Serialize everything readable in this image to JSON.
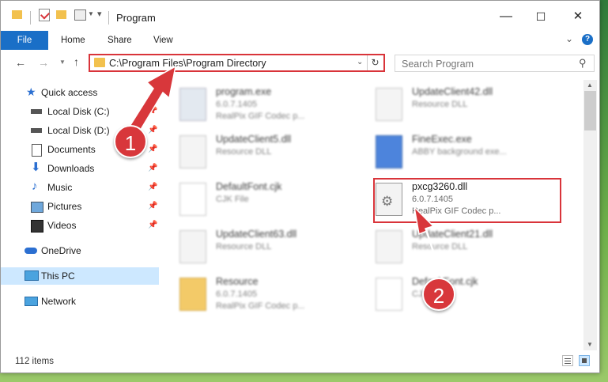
{
  "window": {
    "title": "Program"
  },
  "ribbon": {
    "tabs": [
      "File",
      "Home",
      "Share",
      "View"
    ],
    "help": "?"
  },
  "controls": {
    "minimize": "—",
    "maximize": "☐",
    "close": "✕"
  },
  "address": {
    "path": "C:\\Program Files\\Program Directory",
    "search_placeholder": "Search Program"
  },
  "sidebar": {
    "items": [
      {
        "label": "Quick access",
        "icon": "star-icon"
      },
      {
        "label": "Local Disk (C:)",
        "icon": "drive-icon",
        "pinned": true
      },
      {
        "label": "Local Disk (D:)",
        "icon": "drive-icon",
        "pinned": true
      },
      {
        "label": "Documents",
        "icon": "document-icon",
        "pinned": true
      },
      {
        "label": "Downloads",
        "icon": "download-icon",
        "pinned": true
      },
      {
        "label": "Music",
        "icon": "music-icon",
        "pinned": true
      },
      {
        "label": "Pictures",
        "icon": "picture-icon",
        "pinned": true
      },
      {
        "label": "Videos",
        "icon": "video-icon",
        "pinned": true
      },
      {
        "label": "OneDrive",
        "icon": "cloud-icon"
      },
      {
        "label": "This PC",
        "icon": "computer-icon",
        "selected": true
      },
      {
        "label": "Network",
        "icon": "network-icon"
      }
    ]
  },
  "files": [
    {
      "name": "program.exe",
      "line2": "6.0.7.1405",
      "line3": "RealPix GIF Codec p...",
      "icon": "exe-icon"
    },
    {
      "name": "UpdateClient42.dll",
      "line2": "Resource DLL",
      "line3": "",
      "icon": "dll-icon"
    },
    {
      "name": "UpdateClient5.dll",
      "line2": "Resource DLL",
      "line3": "",
      "icon": "dll-icon"
    },
    {
      "name": "FineExec.exe",
      "line2": "ABBY background exe...",
      "line3": "",
      "icon": "app-icon"
    },
    {
      "name": "DefaultFont.cjk",
      "line2": "CJK File",
      "line3": "",
      "icon": "file-icon"
    },
    {
      "name": "pxcg3260.dll",
      "line2": "6.0.7.1405",
      "line3": "RealPix GIF Codec p...",
      "icon": "dll-icon",
      "highlighted": true
    },
    {
      "name": "UpdateClient63.dll",
      "line2": "Resource DLL",
      "line3": "",
      "icon": "dll-icon"
    },
    {
      "name": "UpdateClient21.dll",
      "line2": "Resource DLL",
      "line3": "",
      "icon": "dll-icon"
    },
    {
      "name": "Resource",
      "line2": "6.0.7.1405",
      "line3": "RealPix GIF Codec p...",
      "icon": "folder-icon"
    },
    {
      "name": "DefaultFont.cjk",
      "line2": "CJK File",
      "line3": "",
      "icon": "file-icon"
    }
  ],
  "status": {
    "items": "112 items"
  },
  "annotations": {
    "step1": "1",
    "step2": "2",
    "color": "#d8373b"
  }
}
